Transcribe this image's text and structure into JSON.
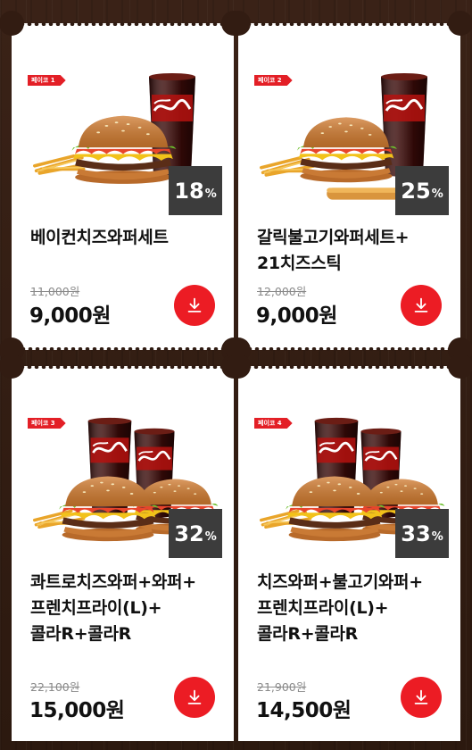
{
  "coupons": [
    {
      "tag": "페이코 1",
      "discount_value": "18",
      "discount_unit": "%",
      "name": "베이컨치즈와퍼세트",
      "original_price": "11,000원",
      "price": "9,000원",
      "download_icon": "download-icon"
    },
    {
      "tag": "페이코 2",
      "discount_value": "25",
      "discount_unit": "%",
      "name": "갈릭불고기와퍼세트+\n21치즈스틱",
      "original_price": "12,000원",
      "price": "9,000원",
      "download_icon": "download-icon"
    },
    {
      "tag": "페이코 3",
      "discount_value": "32",
      "discount_unit": "%",
      "name": "콰트로치즈와퍼+와퍼+\n프렌치프라이(L)+\n콜라R+콜라R",
      "original_price": "22,100원",
      "price": "15,000원",
      "download_icon": "download-icon"
    },
    {
      "tag": "페이코 4",
      "discount_value": "33",
      "discount_unit": "%",
      "name": "치즈와퍼+불고기와퍼+\n프렌치프라이(L)+\n콜라R+콜라R",
      "original_price": "21,900원",
      "price": "14,500원",
      "download_icon": "download-icon"
    }
  ],
  "colors": {
    "accent": "#ec1c24",
    "badge": "#3c3c3c",
    "background": "#3b2318"
  }
}
